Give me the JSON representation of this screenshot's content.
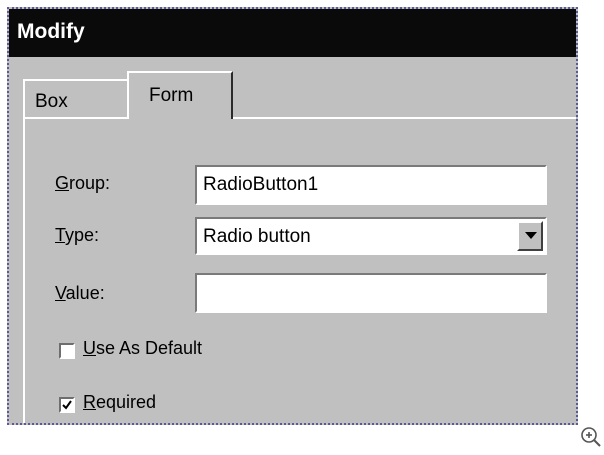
{
  "window": {
    "title": "Modify"
  },
  "tabs": [
    {
      "label": "Box",
      "selected": false
    },
    {
      "label": "Form",
      "selected": true
    }
  ],
  "form": {
    "group": {
      "label_key": "G",
      "label_rest": "roup:",
      "value": "RadioButton1"
    },
    "type": {
      "label_key": "T",
      "label_rest": "ype:",
      "value": "Radio button"
    },
    "value": {
      "label_key": "V",
      "label_rest": "alue:",
      "value": ""
    },
    "use_as_default": {
      "label_key": "U",
      "label_rest": "se As Default",
      "checked": false
    },
    "required": {
      "label_key": "R",
      "label_rest": "equired",
      "checked": true
    }
  },
  "colors": {
    "titlebar": "#0a0a0a",
    "dialog": "#c0c0c0",
    "frame_border": "#5a5a9a"
  },
  "icons": {
    "zoom": "zoom-in-icon",
    "dropdown": "chevron-down-icon",
    "check": "checkmark-icon"
  }
}
